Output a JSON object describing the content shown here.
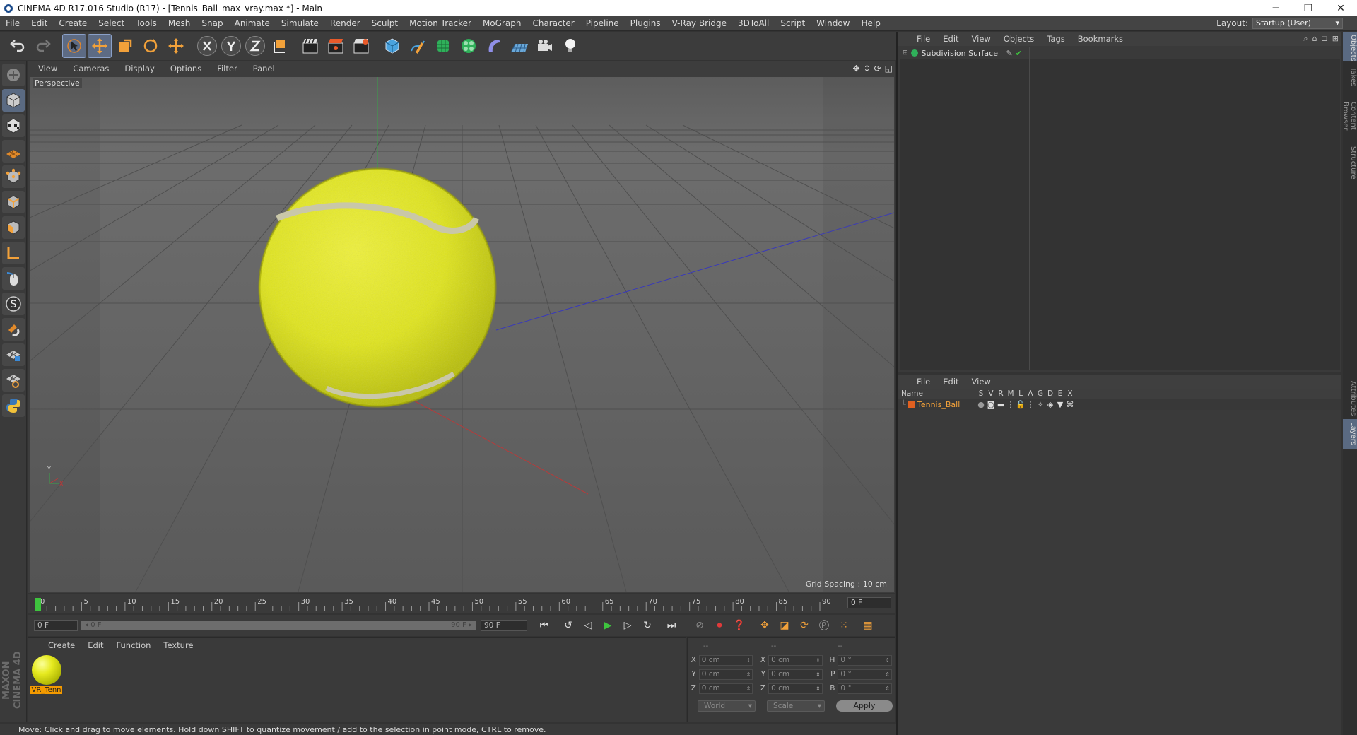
{
  "window": {
    "title": "CINEMA 4D R17.016 Studio (R17) - [Tennis_Ball_max_vray.max *] - Main",
    "minimize": "─",
    "restore": "❐",
    "close": "✕"
  },
  "menubar": {
    "items": [
      "File",
      "Edit",
      "Create",
      "Select",
      "Tools",
      "Mesh",
      "Snap",
      "Animate",
      "Simulate",
      "Render",
      "Sculpt",
      "Motion Tracker",
      "MoGraph",
      "Character",
      "Pipeline",
      "Plugins",
      "V-Ray Bridge",
      "3DToAll",
      "Script",
      "Window",
      "Help"
    ],
    "layout_label": "Layout:",
    "layout_value": "Startup (User)"
  },
  "viewport": {
    "menu": [
      "View",
      "Cameras",
      "Display",
      "Options",
      "Filter",
      "Panel"
    ],
    "label": "Perspective",
    "grid_spacing": "Grid Spacing : 10 cm",
    "nav_icons": [
      "move-view-icon",
      "pan-icon",
      "rotate-view-icon",
      "maximize-icon"
    ]
  },
  "timeline": {
    "ticks": [
      "0",
      "5",
      "10",
      "15",
      "20",
      "25",
      "30",
      "35",
      "40",
      "45",
      "50",
      "55",
      "60",
      "65",
      "70",
      "75",
      "80",
      "85",
      "90"
    ],
    "current_frame": "0 F"
  },
  "transport": {
    "start_field": "0 F",
    "slider_start": "◂ 0 F",
    "slider_end": "90 F ▸",
    "end_field": "90 F"
  },
  "material_manager": {
    "menu": [
      "Create",
      "Edit",
      "Function",
      "Texture"
    ],
    "material_name": "VR_Tenn"
  },
  "coordinates": {
    "header": [
      "--",
      "--",
      "--"
    ],
    "rows": [
      {
        "l1": "X",
        "v1": "0 cm",
        "l2": "X",
        "v2": "0 cm",
        "l3": "H",
        "v3": "0 °"
      },
      {
        "l1": "Y",
        "v1": "0 cm",
        "l2": "Y",
        "v2": "0 cm",
        "l3": "P",
        "v3": "0 °"
      },
      {
        "l1": "Z",
        "v1": "0 cm",
        "l2": "Z",
        "v2": "0 cm",
        "l3": "B",
        "v3": "0 °"
      }
    ],
    "world": "World",
    "scale": "Scale",
    "apply": "Apply"
  },
  "status": {
    "text": "Move: Click and drag to move elements. Hold down SHIFT to quantize movement / add to the selection in point mode, CTRL to remove."
  },
  "objects_panel": {
    "menu": [
      "File",
      "Edit",
      "View",
      "Objects",
      "Tags",
      "Bookmarks"
    ],
    "object": "Subdivision Surface"
  },
  "layers_panel": {
    "menu": [
      "File",
      "Edit",
      "View"
    ],
    "columns": [
      "Name",
      "S",
      "V",
      "R",
      "M",
      "L",
      "A",
      "G",
      "D",
      "E",
      "X"
    ],
    "layer": "Tennis_Ball"
  },
  "side_tabs": {
    "top": [
      "Objects",
      "Takes",
      "Content Browser",
      "Structure"
    ],
    "bottom": [
      "Attributes",
      "Layers"
    ]
  },
  "branding": {
    "maxon": "MAXON CINEMA 4D"
  },
  "colors": {
    "accent": "#5a6a82",
    "ball": "#e3e821",
    "material_tag": "#f39a00"
  }
}
